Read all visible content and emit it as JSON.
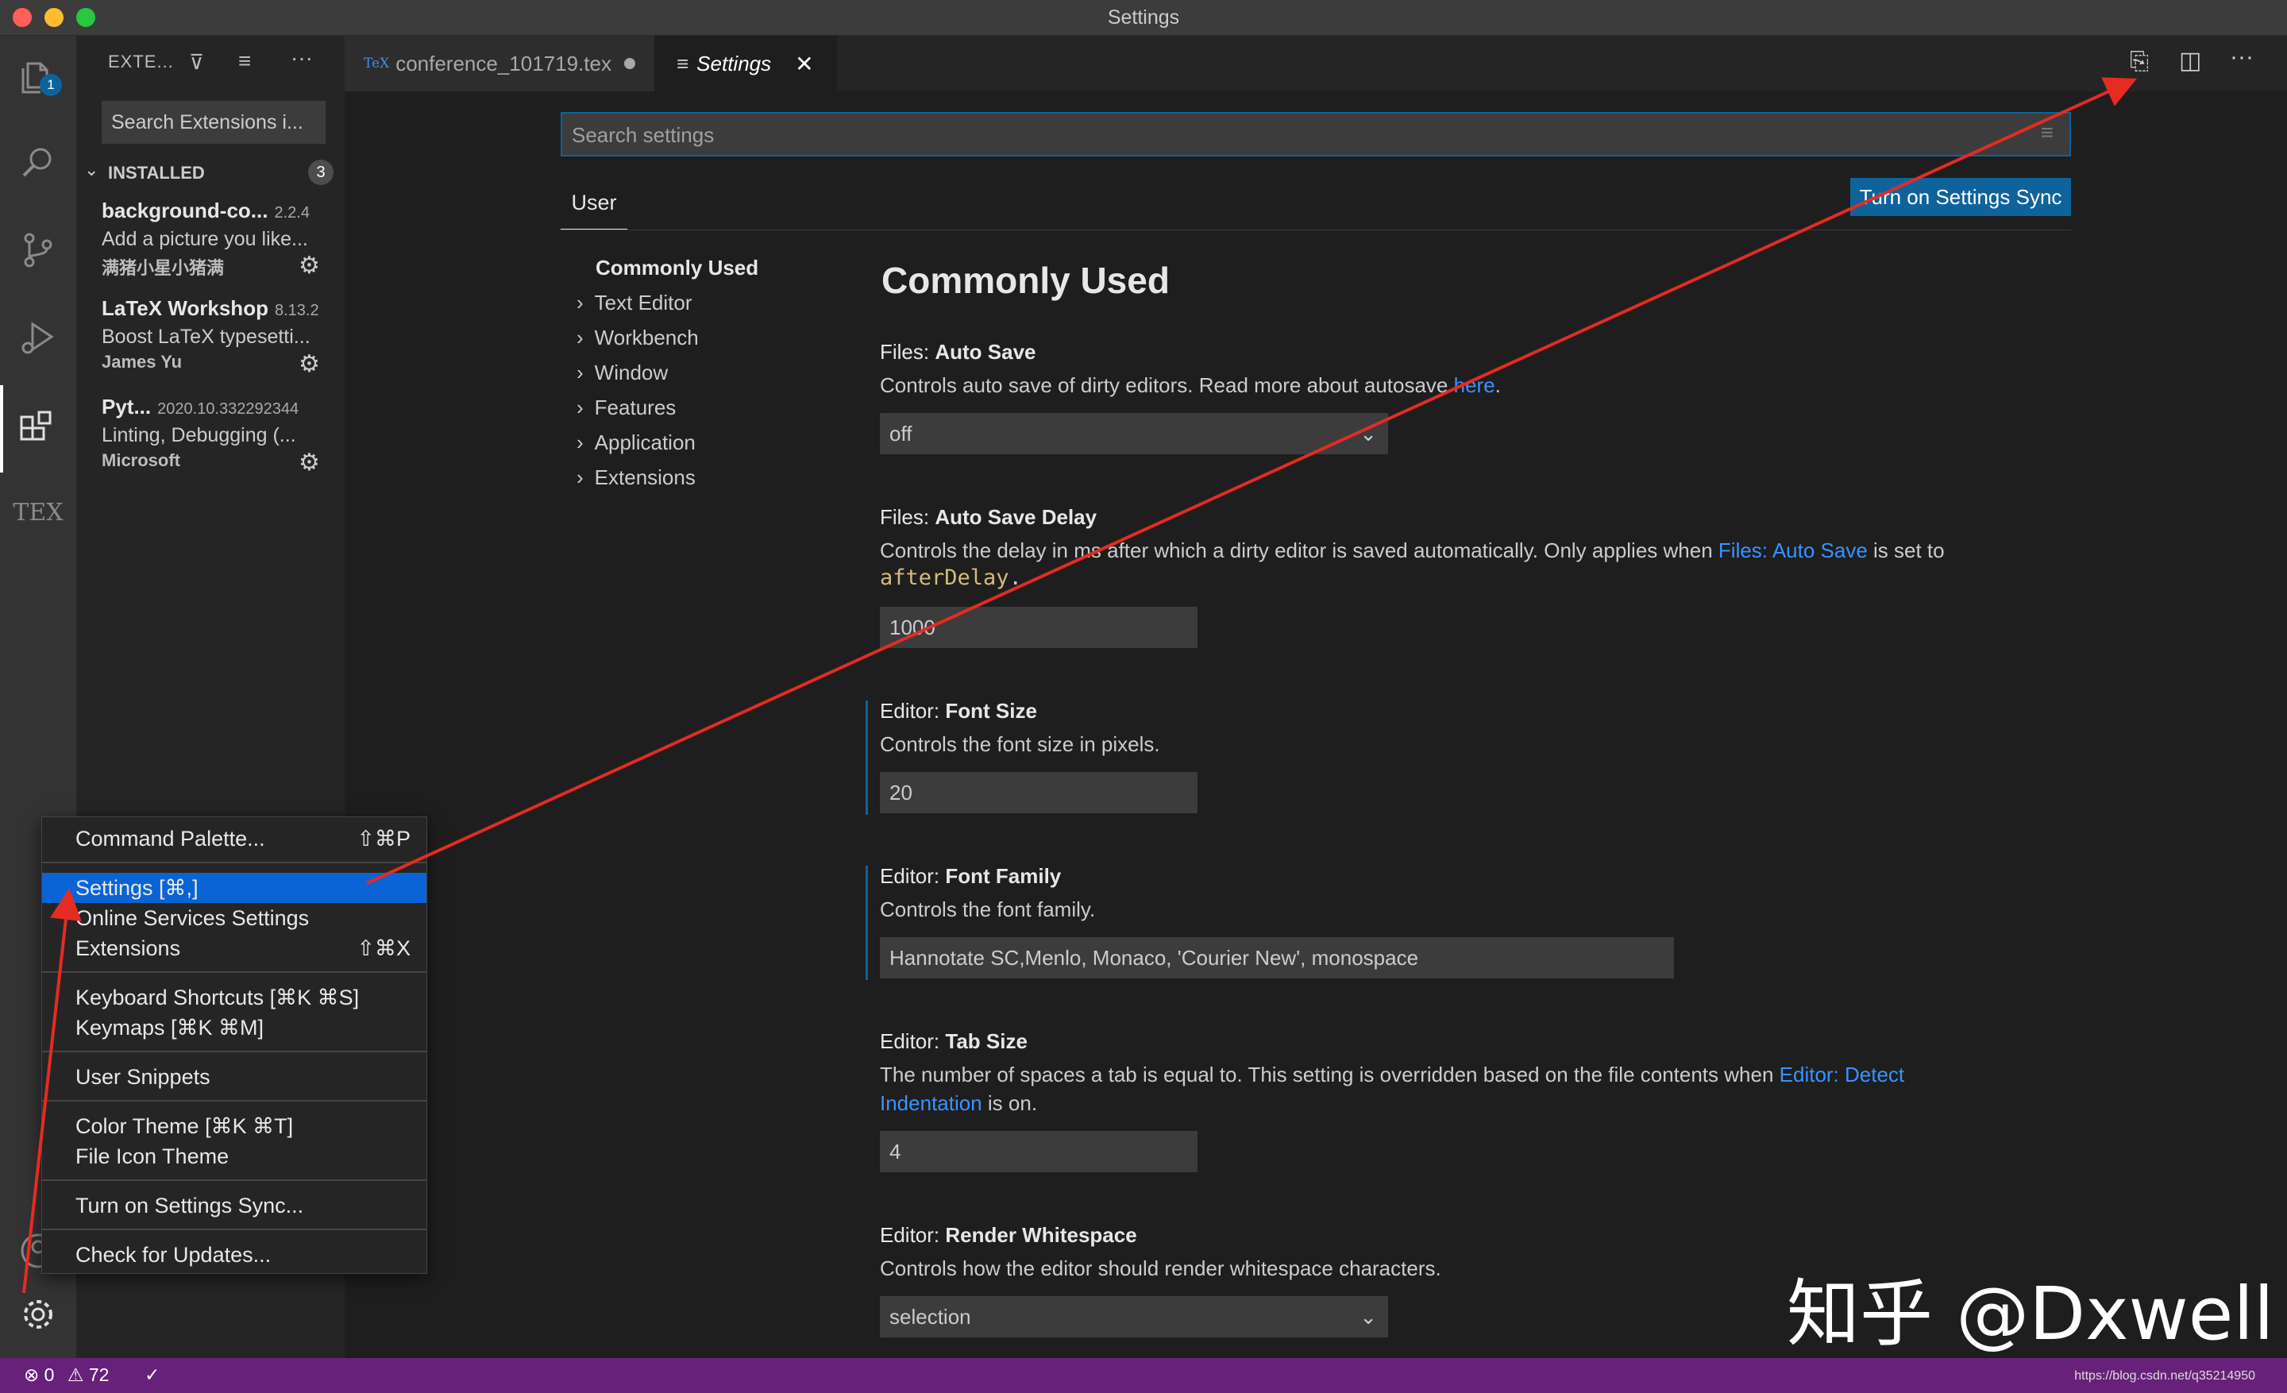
{
  "window": {
    "title": "Settings"
  },
  "sidebar": {
    "header": "EXTE...",
    "search_placeholder": "Search Extensions i...",
    "installed_label": "INSTALLED",
    "installed_count": "3",
    "extensions": [
      {
        "name": "background-co...",
        "version": "2.2.4",
        "description": "Add a picture you like...",
        "publisher": "满猪小星小猪满"
      },
      {
        "name": "LaTeX Workshop",
        "version": "8.13.2",
        "description": "Boost LaTeX typesetti...",
        "publisher": "James Yu"
      },
      {
        "name": "Pyt...",
        "version": "2020.10.332292344",
        "description": "Linting, Debugging (...",
        "publisher": "Microsoft"
      }
    ]
  },
  "activity": {
    "badge": "1",
    "tex_label": "TEX"
  },
  "tabs": [
    {
      "icon": "TeX",
      "label": "conference_101719.tex"
    },
    {
      "icon": "≡",
      "label": "Settings"
    }
  ],
  "settings": {
    "search_placeholder": "Search settings",
    "scope_tab": "User",
    "sync_button": "Turn on Settings Sync",
    "toc": [
      "Commonly Used",
      "Text Editor",
      "Workbench",
      "Window",
      "Features",
      "Application",
      "Extensions"
    ],
    "section_title": "Commonly Used",
    "items": [
      {
        "category": "Files: ",
        "name": "Auto Save",
        "desc": "Controls auto save of dirty editors. Read more about autosave ",
        "link": "here",
        "after": ".",
        "value": "off"
      },
      {
        "category": "Files: ",
        "name": "Auto Save Delay",
        "desc": "Controls the delay in ms after which a dirty editor is saved automatically. Only applies when ",
        "link": "Files: Auto Save",
        "after": " is set to",
        "code": "afterDelay",
        "code_after": ".",
        "value": "1000"
      },
      {
        "category": "Editor: ",
        "name": "Font Size",
        "desc": "Controls the font size in pixels.",
        "value": "20"
      },
      {
        "category": "Editor: ",
        "name": "Font Family",
        "desc": "Controls the font family.",
        "value": "Hannotate SC,Menlo, Monaco, 'Courier New', monospace"
      },
      {
        "category": "Editor: ",
        "name": "Tab Size",
        "desc": "The number of spaces a tab is equal to. This setting is overridden based on the file contents when ",
        "link": "Editor: Detect",
        "link2": "Indentation",
        "after": " is on.",
        "value": "4"
      },
      {
        "category": "Editor: ",
        "name": "Render Whitespace",
        "desc": "Controls how the editor should render whitespace characters.",
        "value": "selection"
      }
    ]
  },
  "menu": {
    "items": [
      {
        "label": "Command Palette...",
        "key": "⇧⌘P"
      },
      {
        "label": "Settings [⌘,]",
        "key": ""
      },
      {
        "label": "Online Services Settings",
        "key": ""
      },
      {
        "label": "Extensions",
        "key": "⇧⌘X"
      },
      {
        "label": "Keyboard Shortcuts [⌘K ⌘S]",
        "key": ""
      },
      {
        "label": "Keymaps [⌘K ⌘M]",
        "key": ""
      },
      {
        "label": "User Snippets",
        "key": ""
      },
      {
        "label": "Color Theme [⌘K ⌘T]",
        "key": ""
      },
      {
        "label": "File Icon Theme",
        "key": ""
      },
      {
        "label": "Turn on Settings Sync...",
        "key": ""
      },
      {
        "label": "Check for Updates...",
        "key": ""
      }
    ]
  },
  "status": {
    "errors": "0",
    "warnings": "72",
    "url": "https://blog.csdn.net/q35214950"
  },
  "watermark": "知乎 @Dxwell",
  "colors": {
    "accent": "#0e639c",
    "statusbar": "#68217a",
    "selection": "#0a64d6",
    "arrow": "#e52b22"
  }
}
